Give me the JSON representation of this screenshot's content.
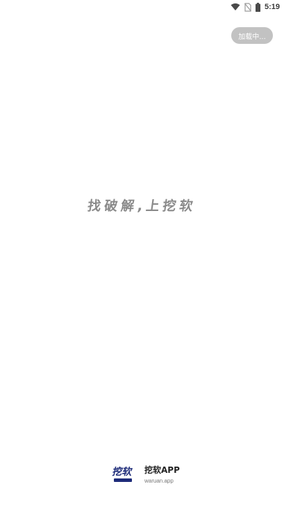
{
  "status_bar": {
    "time": "5:19",
    "icons": [
      "wifi-icon",
      "no-sim-icon",
      "battery-icon"
    ]
  },
  "loading_button": {
    "label": "加载中..."
  },
  "slogan": {
    "text": "找破解,上挖软"
  },
  "footer": {
    "logo_text": "挖软",
    "app_name": "挖软APP",
    "domain": "waruan.app"
  },
  "colors": {
    "background": "#ffffff",
    "pill_bg": "#c2c2c2",
    "slogan_text": "#8a8a8a",
    "logo_brand": "#1c2a78"
  }
}
